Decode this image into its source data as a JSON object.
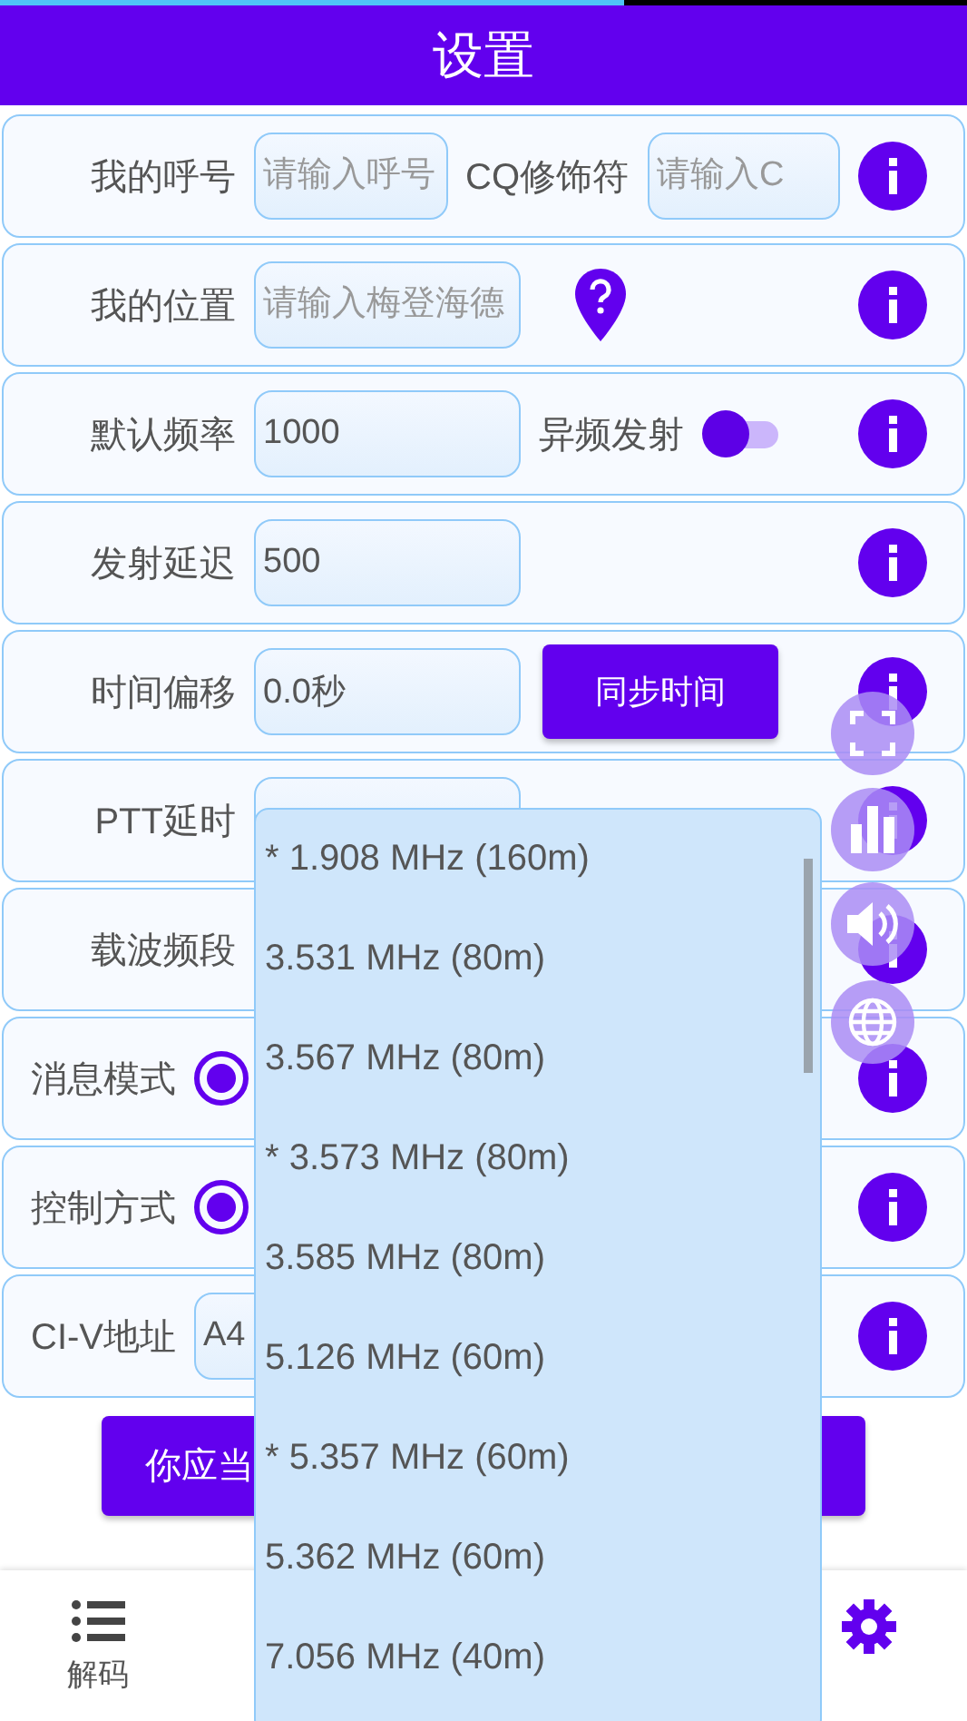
{
  "status_bar": {
    "level": 0.645
  },
  "header": {
    "title": "设置"
  },
  "rows": [
    {
      "kind": "labeled",
      "label": "我的呼号",
      "controls": [
        {
          "kind": "input",
          "placeholder": "请输入呼号"
        },
        {
          "kind": "text",
          "text": "CQ修饰符"
        },
        {
          "kind": "input",
          "placeholder": "请输入C"
        }
      ]
    },
    {
      "kind": "labeled",
      "label": "我的位置",
      "controls": [
        {
          "kind": "input",
          "placeholder": "请输入梅登海德"
        },
        {
          "kind": "pin"
        }
      ]
    },
    {
      "kind": "labeled",
      "label": "默认频率",
      "controls": [
        {
          "kind": "input",
          "value": "1000"
        },
        {
          "kind": "text",
          "text": "异频发射"
        },
        {
          "kind": "toggle",
          "on": true
        }
      ]
    },
    {
      "kind": "labeled",
      "label": "发射延迟",
      "controls": [
        {
          "kind": "input",
          "value": "500"
        }
      ]
    },
    {
      "kind": "labeled",
      "label": "时间偏移",
      "controls": [
        {
          "kind": "input",
          "value": "0.0秒"
        },
        {
          "kind": "button",
          "text": "同步时间"
        }
      ]
    },
    {
      "kind": "labeled",
      "label": "PTT延时",
      "controls": [
        {
          "kind": "input"
        }
      ]
    },
    {
      "kind": "labeled",
      "label": "载波频段",
      "controls": []
    },
    {
      "kind": "inline",
      "label": "消息模式",
      "controls": [
        {
          "kind": "radio",
          "selected": true
        }
      ]
    },
    {
      "kind": "inline",
      "label": "控制方式",
      "controls": [
        {
          "kind": "radio",
          "selected": true
        }
      ]
    },
    {
      "kind": "inline",
      "label": "CI-V地址",
      "controls": [
        {
          "kind": "input",
          "value": "A4"
        }
      ]
    }
  ],
  "buttons": [
    {
      "label": "你应当"
    }
  ],
  "dropdown": {
    "options": [
      {
        "label": "* 1.908 MHz (160m)"
      },
      {
        "label": "3.531 MHz (80m)"
      },
      {
        "label": "3.567 MHz (80m)"
      },
      {
        "label": "* 3.573 MHz (80m)"
      },
      {
        "label": "3.585 MHz (80m)"
      },
      {
        "label": "5.126 MHz (60m)"
      },
      {
        "label": "* 5.357 MHz (60m)"
      },
      {
        "label": "5.362 MHz (60m)"
      },
      {
        "label": "7.056 MHz (40m)"
      }
    ]
  },
  "nav": [
    {
      "kind": "list",
      "label": "解码",
      "selected": false
    },
    {
      "kind": "gear",
      "selected": true
    }
  ]
}
